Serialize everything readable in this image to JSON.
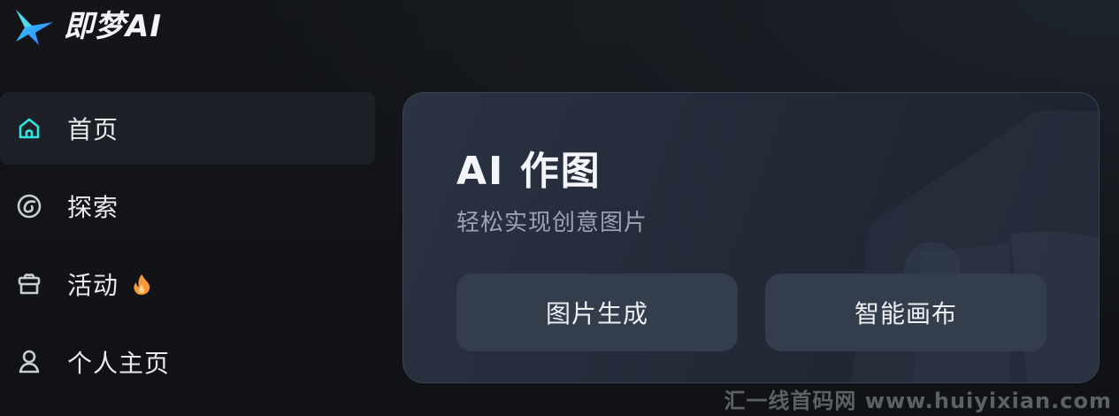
{
  "app": {
    "name": "即梦AI"
  },
  "sidebar": {
    "items": [
      {
        "label": "首页",
        "icon": "home-icon",
        "active": true
      },
      {
        "label": "探索",
        "icon": "explore-icon",
        "active": false
      },
      {
        "label": "活动",
        "icon": "gift-icon",
        "active": false,
        "badge_icon": "fire-icon"
      },
      {
        "label": "个人主页",
        "icon": "user-icon",
        "active": false
      }
    ]
  },
  "card": {
    "title": "AI 作图",
    "subtitle": "轻松实现创意图片",
    "buttons": [
      {
        "label": "图片生成"
      },
      {
        "label": "智能画布"
      }
    ]
  },
  "watermark": {
    "text": "汇一线首码网 www.huiyixian.com"
  },
  "colors": {
    "background": "#121418",
    "active_item_bg": "#1d2127",
    "card_bg": "#2b3344",
    "card_button_bg": "#343d4c",
    "accent_cyan": "#2ee6e0",
    "fire_orange": "#f59a3a"
  }
}
